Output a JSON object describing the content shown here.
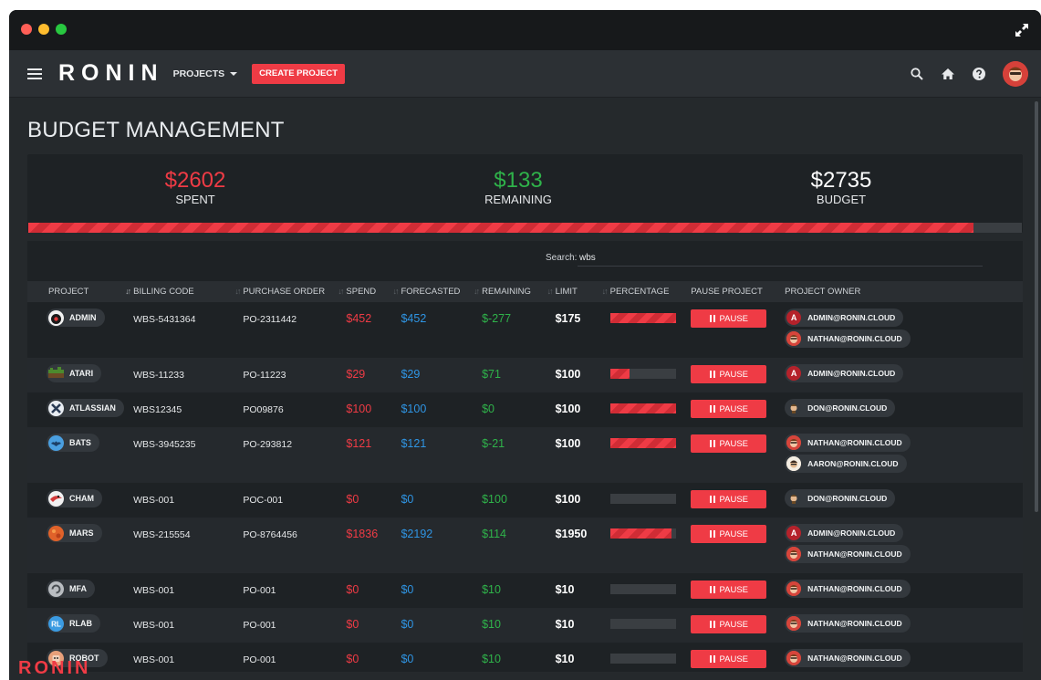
{
  "app": {
    "brand": "RONIN",
    "projects_menu": "PROJECTS",
    "create_project": "CREATE PROJECT"
  },
  "page": {
    "title": "BUDGET MANAGEMENT"
  },
  "summary": {
    "spent_amount": "$2602",
    "spent_label": "SPENT",
    "remaining_amount": "$133",
    "remaining_label": "REMAINING",
    "budget_amount": "$2735",
    "budget_label": "BUDGET",
    "spent_fraction": 0.9514
  },
  "search": {
    "label": "Search:",
    "value": "wbs"
  },
  "columns": [
    "PROJECT",
    "BILLING CODE",
    "PURCHASE ORDER",
    "SPEND",
    "FORECASTED",
    "REMAINING",
    "LIMIT",
    "PERCENTAGE",
    "PAUSE PROJECT",
    "PROJECT OWNER"
  ],
  "pause_label": "PAUSE",
  "rows": [
    {
      "project": "ADMIN",
      "icon": "bomb-icon",
      "billing": "WBS-5431364",
      "po": "PO-2311442",
      "spend": "$452",
      "forecast": "$452",
      "remaining": "$-277",
      "limit": "$175",
      "pct": 1.0,
      "owners": [
        {
          "email": "ADMIN@RONIN.CLOUD",
          "av": "admin"
        },
        {
          "email": "NATHAN@RONIN.CLOUD",
          "av": "nathan"
        }
      ]
    },
    {
      "project": "ATARI",
      "icon": "atari-icon",
      "billing": "WBS-11233",
      "po": "PO-11223",
      "spend": "$29",
      "forecast": "$29",
      "remaining": "$71",
      "limit": "$100",
      "pct": 0.29,
      "owners": [
        {
          "email": "ADMIN@RONIN.CLOUD",
          "av": "admin"
        }
      ]
    },
    {
      "project": "ATLASSIAN",
      "icon": "atlassian-icon",
      "billing": "WBS12345",
      "po": "PO09876",
      "spend": "$100",
      "forecast": "$100",
      "remaining": "$0",
      "limit": "$100",
      "pct": 1.0,
      "owners": [
        {
          "email": "DON@RONIN.CLOUD",
          "av": "don"
        }
      ]
    },
    {
      "project": "BATS",
      "icon": "bat-icon",
      "billing": "WBS-3945235",
      "po": "PO-293812",
      "spend": "$121",
      "forecast": "$121",
      "remaining": "$-21",
      "limit": "$100",
      "pct": 1.0,
      "owners": [
        {
          "email": "NATHAN@RONIN.CLOUD",
          "av": "nathan"
        },
        {
          "email": "AARON@RONIN.CLOUD",
          "av": "aaron"
        }
      ]
    },
    {
      "project": "CHAM",
      "icon": "chameleon-icon",
      "billing": "WBS-001",
      "po": "POC-001",
      "spend": "$0",
      "forecast": "$0",
      "remaining": "$100",
      "limit": "$100",
      "pct": 0.0,
      "owners": [
        {
          "email": "DON@RONIN.CLOUD",
          "av": "don"
        }
      ]
    },
    {
      "project": "MARS",
      "icon": "mars-icon",
      "billing": "WBS-215554",
      "po": "PO-8764456",
      "spend": "$1836",
      "forecast": "$2192",
      "remaining": "$114",
      "limit": "$1950",
      "pct": 0.94,
      "owners": [
        {
          "email": "ADMIN@RONIN.CLOUD",
          "av": "admin"
        },
        {
          "email": "NATHAN@RONIN.CLOUD",
          "av": "nathan"
        }
      ]
    },
    {
      "project": "MFA",
      "icon": "mfa-icon",
      "billing": "WBS-001",
      "po": "PO-001",
      "spend": "$0",
      "forecast": "$0",
      "remaining": "$10",
      "limit": "$10",
      "pct": 0.0,
      "owners": [
        {
          "email": "NATHAN@RONIN.CLOUD",
          "av": "nathan"
        }
      ]
    },
    {
      "project": "RLAB",
      "icon": "rlab-icon",
      "billing": "WBS-001",
      "po": "PO-001",
      "spend": "$0",
      "forecast": "$0",
      "remaining": "$10",
      "limit": "$10",
      "pct": 0.0,
      "owners": [
        {
          "email": "NATHAN@RONIN.CLOUD",
          "av": "nathan"
        }
      ]
    },
    {
      "project": "ROBOT",
      "icon": "robot-icon",
      "billing": "WBS-001",
      "po": "PO-001",
      "spend": "$0",
      "forecast": "$0",
      "remaining": "$10",
      "limit": "$10",
      "pct": 0.0,
      "owners": [
        {
          "email": "NATHAN@RONIN.CLOUD",
          "av": "nathan"
        }
      ]
    }
  ],
  "watermark": "RONIN",
  "colors": {
    "accent": "#ef3b45",
    "positive": "#2fb34a",
    "forecast": "#2f95e4",
    "bg": "#25292c"
  }
}
